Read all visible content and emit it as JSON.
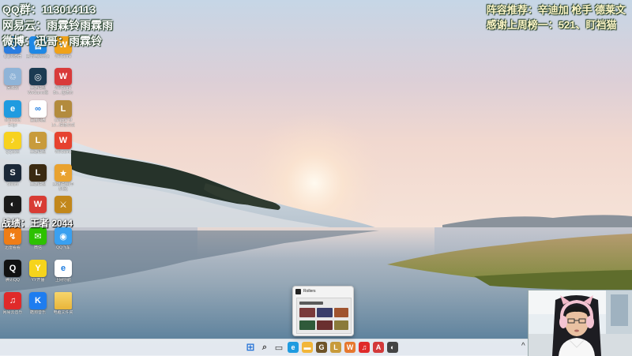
{
  "overlay": {
    "qq_group": "QQ群：113014113",
    "netease": "网易云：雨霖铃雨霖雨",
    "weibo": "微博：迅哥：雨霖铃",
    "recommend": "阵容推荐：辛迪加 枪手 德莱文",
    "thanks": "感谢上周榜一：521、盯裆猫",
    "record": "战绩：王者 2044"
  },
  "desktop_icons": [
    {
      "label": "QQ浏览器",
      "icon": "qq-browser-icon",
      "color": "#2a7de1",
      "glyph": "Q"
    },
    {
      "label": "腾讯电脑管家",
      "icon": "pc-manager-icon",
      "color": "#1e88e5",
      "glyph": "管"
    },
    {
      "label": "WeGame",
      "icon": "wegame-icon",
      "color": "#f0a21a",
      "glyph": "W"
    },
    {
      "label": "回收站",
      "icon": "recycle-bin-icon",
      "color": "#8fb4d8",
      "glyph": "♲"
    },
    {
      "label": "英雄联盟WeGame版",
      "icon": "lol-wegame-icon",
      "color": "#1b3b52",
      "glyph": "◎"
    },
    {
      "label": "WeGame Bo...快捷方式",
      "icon": "wegame-red-icon",
      "color": "#d93a3a",
      "glyph": "W"
    },
    {
      "label": "Microsoft Edge",
      "icon": "edge-icon",
      "color": "#1f9be0",
      "glyph": "e"
    },
    {
      "label": "百度网盘",
      "icon": "baidu-netdisk-icon",
      "color": "#ffffff",
      "glyph": "∞"
    },
    {
      "label": "League of Le...快捷方式",
      "icon": "league-icon",
      "color": "#b38b3d",
      "glyph": "L"
    },
    {
      "label": "QQ音乐",
      "icon": "qq-music-icon",
      "color": "#f7d21e",
      "glyph": "♪"
    },
    {
      "label": "英雄联盟",
      "icon": "lol-icon",
      "color": "#c89b3c",
      "glyph": "L"
    },
    {
      "label": "WeGame",
      "icon": "wegame-flame-icon",
      "color": "#e6422f",
      "glyph": "W"
    },
    {
      "label": "Steam",
      "icon": "steam-icon",
      "color": "#1b2838",
      "glyph": "S"
    },
    {
      "label": "英雄联盟",
      "icon": "lol-gold-icon",
      "color": "#3a2a12",
      "glyph": "L"
    },
    {
      "label": "英雄联盟(单机版)",
      "icon": "lol-offline-icon",
      "color": "#e9a22f",
      "glyph": "★"
    },
    {
      "label": "",
      "icon": "game-icon",
      "color": "#1a1a1a",
      "glyph": "◐"
    },
    {
      "label": "",
      "icon": "wegame-small-icon",
      "color": "#d83b34",
      "glyph": "W"
    },
    {
      "label": "",
      "icon": "lol-swords-icon",
      "color": "#c2871b",
      "glyph": "⚔"
    },
    {
      "label": "迅雷看看",
      "icon": "xunlei-icon",
      "color": "#ef7d16",
      "glyph": "↯"
    },
    {
      "label": "微信",
      "icon": "wechat-icon",
      "color": "#2dc100",
      "glyph": "✉"
    },
    {
      "label": "QQ飞车",
      "icon": "qq-speed-icon",
      "color": "#3aa0f0",
      "glyph": "◉"
    },
    {
      "label": "腾讯QQ",
      "icon": "qq-icon",
      "color": "#111111",
      "glyph": "Q"
    },
    {
      "label": "YY开播",
      "icon": "yy-icon",
      "color": "#f6d41c",
      "glyph": "Y"
    },
    {
      "label": "上网导航",
      "icon": "ie-icon",
      "color": "#ffffff",
      "glyph": "e"
    },
    {
      "label": "网易云音乐",
      "icon": "netease-music-icon",
      "color": "#e02a2a",
      "glyph": "♫"
    },
    {
      "label": "酷狗音乐",
      "icon": "kugou-icon",
      "color": "#1e7df0",
      "glyph": "K"
    },
    {
      "label": "电脑文件夹",
      "icon": "folder-icon",
      "color": "#f4c54a",
      "glyph": ""
    }
  ],
  "taskbar": {
    "icons": [
      {
        "name": "start-icon",
        "color": "#1f6fd6",
        "glyph": "⊞"
      },
      {
        "name": "search-icon",
        "color": "#444444",
        "glyph": "⌕"
      },
      {
        "name": "task-view-icon",
        "color": "#333333",
        "glyph": "▭"
      },
      {
        "name": "edge-taskbar-icon",
        "color": "#1f9be0",
        "glyph": "e"
      },
      {
        "name": "file-explorer-icon",
        "color": "#f2b63a",
        "glyph": "▬"
      },
      {
        "name": "league-taskbar-icon",
        "color": "#6f5428",
        "glyph": "G"
      },
      {
        "name": "lol-taskbar-icon",
        "color": "#c89b3c",
        "glyph": "L"
      },
      {
        "name": "wegame-taskbar-icon",
        "color": "#e6782f",
        "glyph": "W"
      },
      {
        "name": "netease-taskbar-icon",
        "color": "#e02a2a",
        "glyph": "♫"
      },
      {
        "name": "app-taskbar-icon",
        "color": "#d3393a",
        "glyph": "A"
      },
      {
        "name": "lol-gold-taskbar-icon",
        "color": "#444444",
        "glyph": "◐"
      }
    ],
    "tray_chevron": "^"
  },
  "task_preview": {
    "title": "Rollers"
  }
}
